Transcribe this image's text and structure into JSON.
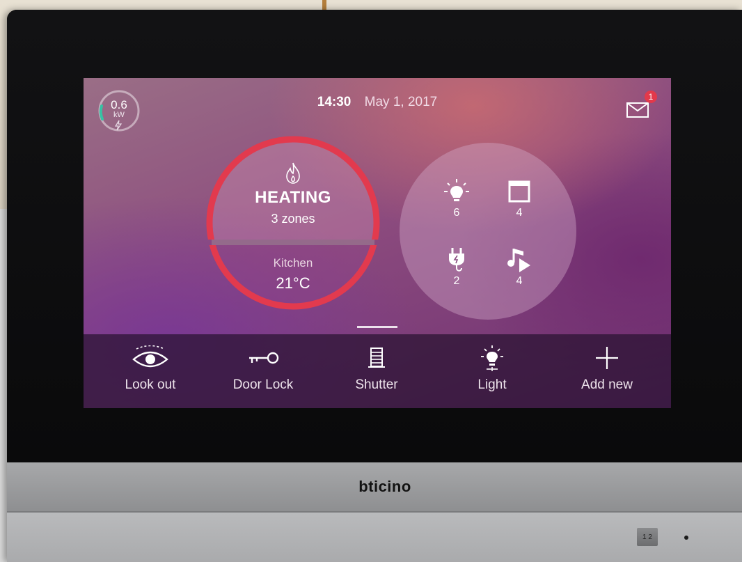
{
  "power": {
    "value": "0.6",
    "unit": "kW",
    "level": 0.3
  },
  "header": {
    "time": "14:30",
    "date": "May 1, 2017"
  },
  "notifications": {
    "count": "1"
  },
  "heating": {
    "title": "HEATING",
    "zones": "3 zones",
    "room": "Kitchen",
    "temperature": "21°C"
  },
  "devices": [
    {
      "icon": "light-bulb-icon",
      "count": "6"
    },
    {
      "icon": "shutter-icon",
      "count": "4"
    },
    {
      "icon": "plug-icon",
      "count": "2"
    },
    {
      "icon": "music-icon",
      "count": "4"
    }
  ],
  "shortcuts": [
    {
      "icon": "eye-icon",
      "label": "Look out"
    },
    {
      "icon": "key-icon",
      "label": "Door Lock"
    },
    {
      "icon": "shutter-icon",
      "label": "Shutter"
    },
    {
      "icon": "light-bulb-icon",
      "label": "Light"
    },
    {
      "icon": "plus-icon",
      "label": "Add new"
    }
  ],
  "brand": "bticino",
  "panel_button": "1 2",
  "colors": {
    "heating_ring": "#e23a4e",
    "badge": "#e2394b",
    "power_arc": "#36c2a4"
  }
}
